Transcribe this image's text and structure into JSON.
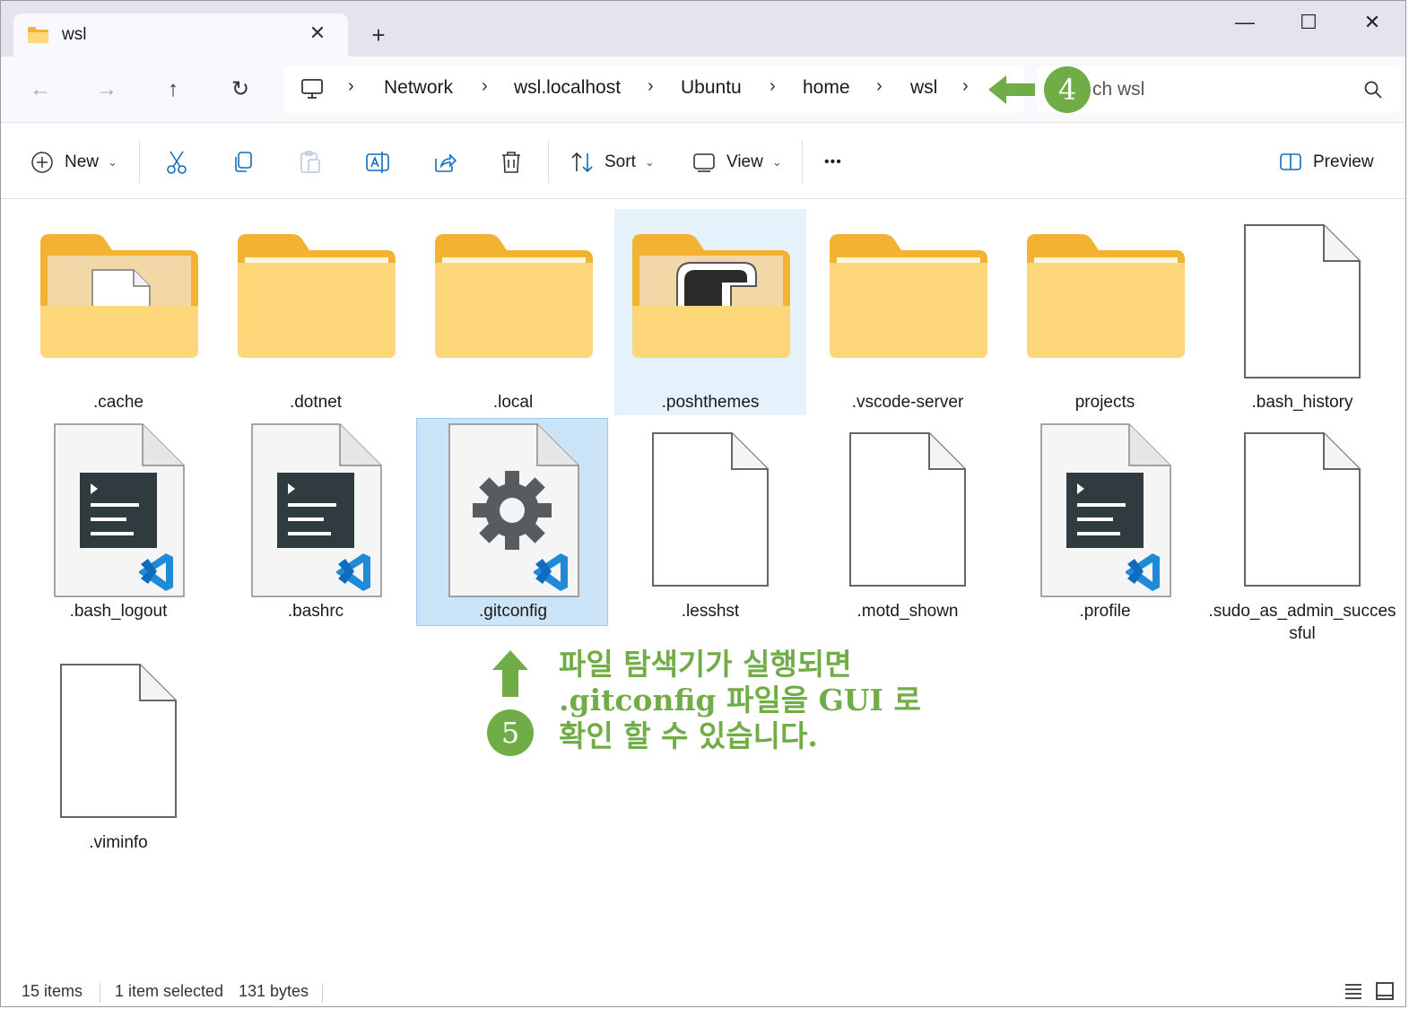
{
  "window": {
    "tab_title": "wsl",
    "tab_close_glyph": "✕",
    "new_tab_glyph": "+",
    "minimize_glyph": "—",
    "maximize_glyph": "☐",
    "close_glyph": "✕"
  },
  "nav": {
    "back_glyph": "←",
    "forward_glyph": "→",
    "up_glyph": "↑",
    "refresh_glyph": "↻"
  },
  "breadcrumb": {
    "items": [
      "Network",
      "wsl.localhost",
      "Ubuntu",
      "home",
      "wsl"
    ],
    "separator": "›"
  },
  "search": {
    "placeholder": "ch wsl"
  },
  "toolbar": {
    "new_label": "New",
    "sort_label": "Sort",
    "view_label": "View",
    "more_label": "•••",
    "preview_label": "Preview",
    "caret": "⌄"
  },
  "files": [
    {
      "name": ".cache",
      "kind": "folder-file"
    },
    {
      "name": ".dotnet",
      "kind": "folder"
    },
    {
      "name": ".local",
      "kind": "folder"
    },
    {
      "name": ".poshthemes",
      "kind": "folder-posh",
      "state": "hover"
    },
    {
      "name": ".vscode-server",
      "kind": "folder"
    },
    {
      "name": "projects",
      "kind": "folder"
    },
    {
      "name": ".bash_history",
      "kind": "blank"
    },
    {
      "name": ".bash_logout",
      "kind": "vscode-text"
    },
    {
      "name": ".bashrc",
      "kind": "vscode-text"
    },
    {
      "name": ".gitconfig",
      "kind": "vscode-gear",
      "state": "selected"
    },
    {
      "name": ".lesshst",
      "kind": "blank"
    },
    {
      "name": ".motd_shown",
      "kind": "blank"
    },
    {
      "name": ".profile",
      "kind": "vscode-text"
    },
    {
      "name": ".sudo_as_admin_succes",
      "name_line2": "sful",
      "kind": "blank"
    },
    {
      "name": ".viminfo",
      "kind": "blank"
    }
  ],
  "annotations": {
    "step4_number": "4",
    "step5_number": "5",
    "step5_text_line1": "파일 탐색기가 실행되면",
    "step5_text_line2": ".gitconfig 파일을 GUI 로",
    "step5_text_line3": "확인 할 수 있습니다.",
    "accent_color": "#70ad47"
  },
  "status": {
    "item_count": "15 items",
    "selection": "1 item selected",
    "size": "131 bytes"
  },
  "colors": {
    "folder_back": "#f2b233",
    "folder_front": "#fdd77a",
    "selection": "#cce4f7",
    "hover": "#e5f1fb",
    "icon_blue": "#0f6cbd"
  }
}
